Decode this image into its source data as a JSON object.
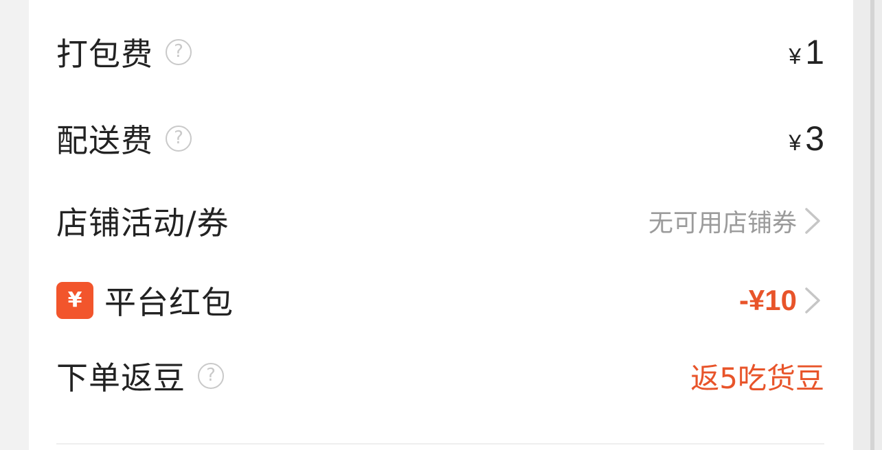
{
  "rows": {
    "packing_fee": {
      "label": "打包费",
      "currency": "¥",
      "amount": "1"
    },
    "delivery_fee": {
      "label": "配送费",
      "currency": "¥",
      "amount": "3"
    },
    "store_promo": {
      "label": "店铺活动/券",
      "value": "无可用店铺券"
    },
    "platform_red_packet": {
      "badge": "¥",
      "label": "平台红包",
      "value": "-¥10"
    },
    "order_beans": {
      "label": "下单返豆",
      "value": "返5吃货豆"
    }
  },
  "help_glyph": "?",
  "colors": {
    "accent": "#e8542a",
    "badge_bg": "#f2552c",
    "text": "#222222",
    "muted": "#9b9b9b"
  },
  "icons": {
    "help": "question-circle-icon",
    "chevron": "chevron-right-icon",
    "badge": "yen-badge-icon"
  }
}
